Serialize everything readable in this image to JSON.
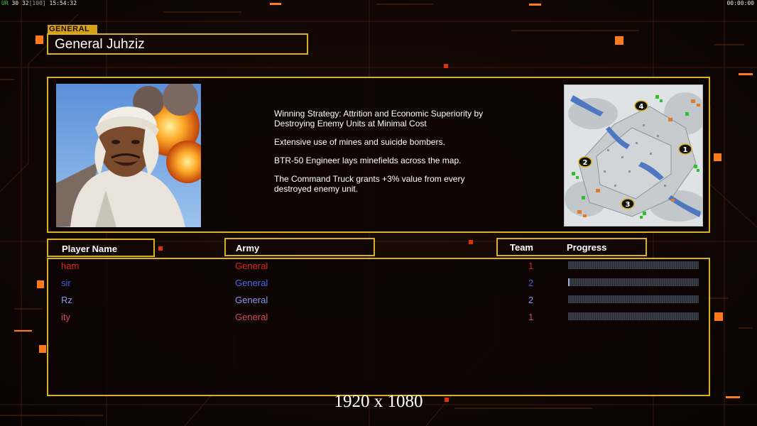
{
  "hud": {
    "fps_label": "ÜR",
    "fps_a": "30",
    "fps_b": "32",
    "fps_cap": "[100]",
    "clock": "15:54:32",
    "game_timer": "00:00:00"
  },
  "general": {
    "tag": "GENERAL",
    "name": "General Juhziz",
    "strategy": "Winning Strategy: Attrition and Economic Superiority by\n Destroying Enemy Units at Minimal Cost",
    "ability_1": "Extensive use of mines and suicide bombers.",
    "ability_2": "BTR-50 Engineer lays minefields across the map.",
    "ability_3": "The Command Truck grants +3% value from every\n destroyed enemy unit."
  },
  "map": {
    "start_positions": [
      "1",
      "2",
      "3",
      "4"
    ]
  },
  "table": {
    "headers": {
      "player": "Player Name",
      "army": "Army",
      "team": "Team",
      "progress": "Progress"
    },
    "rows": [
      {
        "name": "ham",
        "army": "General",
        "team": "1",
        "progress": 0.0,
        "color": "#e0241b",
        "army_color": "#e0241b"
      },
      {
        "name": "sir",
        "army": "General",
        "team": "2",
        "progress": 0.01,
        "color": "#3f5fe0",
        "army_color": "#4a67e6"
      },
      {
        "name": "Rz",
        "army": "General",
        "team": "2",
        "progress": 0.0,
        "color": "#8d94e8",
        "army_color": "#8d94e8"
      },
      {
        "name": "ity",
        "army": "General",
        "team": "1",
        "progress": 0.0,
        "color": "#d24b52",
        "army_color": "#d24b52"
      }
    ]
  },
  "resolution": "1920 x 1080",
  "colors": {
    "frame": "#d8b21e",
    "accent_orange": "#ff7a1a"
  }
}
